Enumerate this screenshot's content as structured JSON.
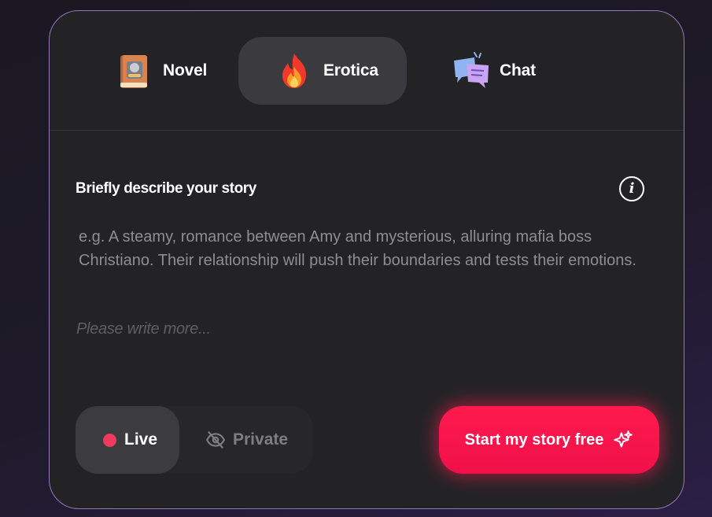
{
  "tabs": [
    {
      "id": "novel",
      "label": "Novel",
      "icon": "book-icon"
    },
    {
      "id": "erotica",
      "label": "Erotica",
      "icon": "fire-icon",
      "selected": true
    },
    {
      "id": "chat",
      "label": "Chat",
      "icon": "chat-bubbles-icon"
    }
  ],
  "describe": {
    "label": "Briefly describe your story",
    "info_icon": "info-icon",
    "placeholder": "e.g. A steamy, romance between Amy and mysterious, alluring mafia boss Christiano. Their relationship will push their boundaries and tests their emotions.",
    "hint": "Please write more..."
  },
  "visibility": {
    "live_label": "Live",
    "private_label": "Private",
    "selected": "Live"
  },
  "start_button": {
    "label": "Start my story free",
    "icon": "sparkle-icon"
  },
  "colors": {
    "accent": "#ff1a4d",
    "card_border": "#8f7ab8",
    "live_dot": "#ee3a5c"
  }
}
